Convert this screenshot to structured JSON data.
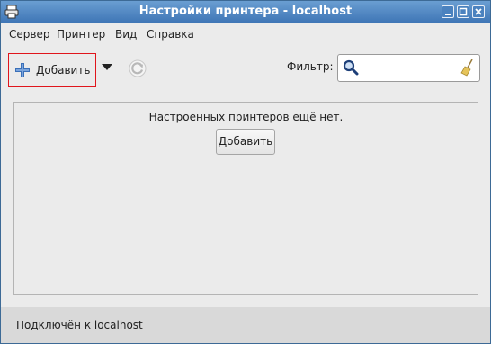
{
  "window": {
    "title": "Настройки принтера - localhost"
  },
  "menubar": {
    "items": [
      "Сервер",
      "Принтер",
      "Вид",
      "Справка"
    ]
  },
  "toolbar": {
    "add_label": "Добавить",
    "add_icon": "plus-icon",
    "dropdown_icon": "dropdown-arrow-icon",
    "refresh_icon": "refresh-icon",
    "filter_label": "Фильтр:",
    "filter_value": ""
  },
  "main": {
    "empty_message": "Настроенных принтеров ещё нет.",
    "add_button_label": "Добавить"
  },
  "status": {
    "text": "Подключён к localhost"
  },
  "colors": {
    "titlebar": "#4f87c2",
    "highlight_border": "#e0151c",
    "background": "#ebebeb"
  }
}
